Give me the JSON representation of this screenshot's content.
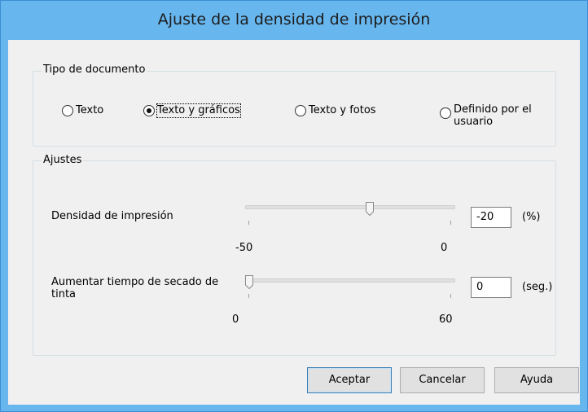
{
  "window": {
    "title": "Ajuste de la densidad de impresión"
  },
  "document_type": {
    "group_label": "Tipo de documento",
    "options": [
      {
        "label": "Texto",
        "checked": false
      },
      {
        "label": "Texto y gráficos",
        "checked": true
      },
      {
        "label": "Texto y fotos",
        "checked": false
      },
      {
        "label": "Definido por el usuario",
        "checked": false
      }
    ]
  },
  "settings": {
    "group_label": "Ajustes",
    "density": {
      "label": "Densidad de impresión",
      "min_label": "-50",
      "max_label": "0",
      "value": "-20",
      "unit": "(%)",
      "min": -50,
      "max": 0,
      "current": -20
    },
    "dry_time": {
      "label": "Aumentar tiempo de secado de tinta",
      "min_label": "0",
      "max_label": "60",
      "value": "0",
      "unit": "(seg.)",
      "min": 0,
      "max": 60,
      "current": 0
    }
  },
  "buttons": {
    "ok": "Aceptar",
    "cancel": "Cancelar",
    "help": "Ayuda"
  },
  "colors": {
    "title_bar": "#67b6ee",
    "dialog_bg": "#f0f0f0",
    "default_button_border": "#3c7fb1"
  }
}
